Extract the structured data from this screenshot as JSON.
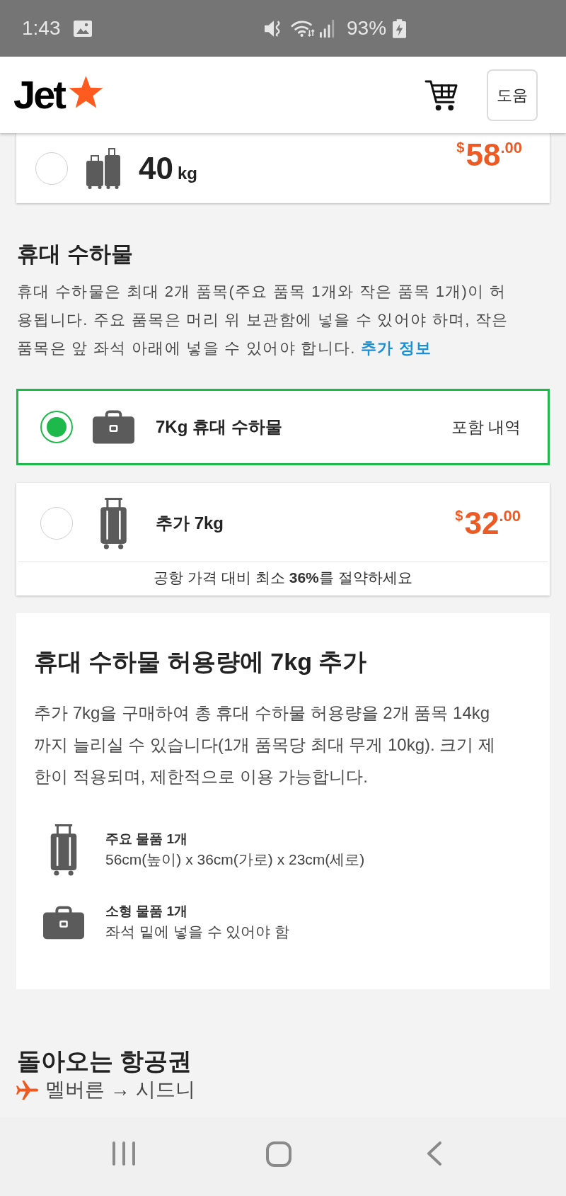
{
  "status_bar": {
    "time": "1:43",
    "battery": "93%"
  },
  "header": {
    "logo": "Jet",
    "help_button": "도움"
  },
  "checked_bag": {
    "selected": false,
    "weight": "40",
    "unit": "kg",
    "price": {
      "currency": "$",
      "amount": "58",
      "cents": ".00"
    }
  },
  "carry_on": {
    "title": "휴대 수하물",
    "description": "휴대 수하물은 최대 2개 품목(주요 품목 1개와 작은 품목 1개)이 허용됩니다. 주요 품목은 머리 위 보관함에 넣을 수 있어야 하며, 작은 품목은 앞 좌석 아래에 넣을 수 있어야 합니다.",
    "more_link": "추가 정보",
    "options": [
      {
        "kind": "included",
        "selected": true,
        "label": "7Kg 휴대 수하물",
        "note": "포함 내역"
      },
      {
        "kind": "extra",
        "selected": false,
        "label": "추가 7kg",
        "price": {
          "currency": "$",
          "amount": "32",
          "cents": ".00"
        },
        "savings": "공항 가격 대비 최소 **36%**를 절약하세요"
      }
    ]
  },
  "info": {
    "title": "휴대 수하물 허용량에 7kg 추가",
    "body": "추가 7kg을 구매하여 총 휴대 수하물 허용량을 2개 품목 14kg까지 늘리실 수 있습니다(1개 품목당 최대 무게 10kg). 크기 제한이 적용되며, 제한적으로 이용 가능합니다.",
    "items": [
      {
        "kind": "main",
        "title": "주요 물품 1개",
        "detail": "56cm(높이) x 36cm(가로) x 23cm(세로)"
      },
      {
        "kind": "small",
        "title": "소형 물품 1개",
        "detail": "좌석 밑에 넣을 수 있어야 함"
      }
    ]
  },
  "return_flight": {
    "title": "돌아오는 항공권",
    "route": "멜버른 → 시드니"
  }
}
